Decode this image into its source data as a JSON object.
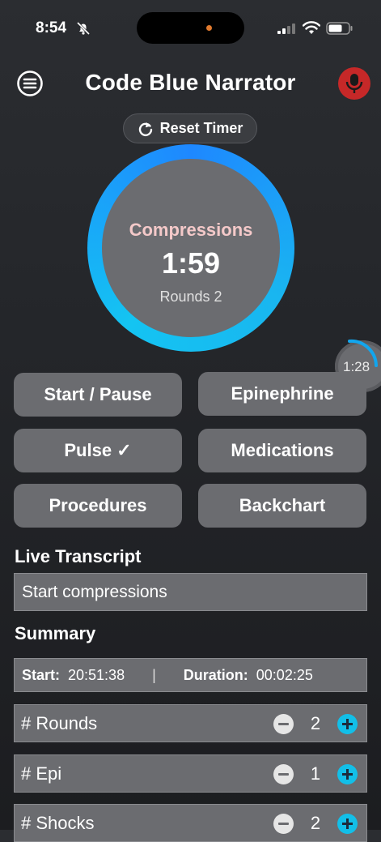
{
  "status": {
    "time": "8:54"
  },
  "header": {
    "title": "Code Blue Narrator"
  },
  "reset": {
    "label": "Reset Timer"
  },
  "timer": {
    "phase": "Compressions",
    "value": "1:59",
    "rounds": "Rounds 2"
  },
  "epi_timer": {
    "value": "1:28"
  },
  "actions": [
    "Start / Pause",
    "Epinephrine",
    "Pulse ✓",
    "Medications",
    "Procedures",
    "Backchart"
  ],
  "transcript": {
    "heading": "Live Transcript",
    "text": "Start compressions"
  },
  "summary": {
    "heading": "Summary",
    "start_label": "Start:",
    "start_value": "20:51:38",
    "separator": "|",
    "duration_label": "Duration:",
    "duration_value": "00:02:25"
  },
  "counters": [
    {
      "label": "# Rounds",
      "value": "2"
    },
    {
      "label": "# Epi",
      "value": "1"
    },
    {
      "label": "# Shocks",
      "value": "2"
    }
  ],
  "colors": {
    "ring_blue": "#1e88ff",
    "accent_cyan": "#12bfe8",
    "mic_red": "#c62828",
    "phase_pink": "#f4c9c9"
  }
}
